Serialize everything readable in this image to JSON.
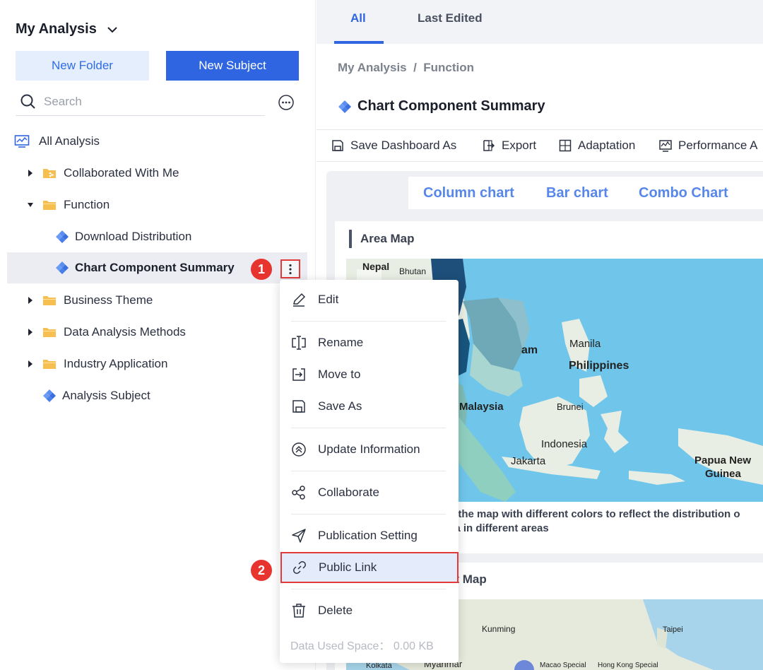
{
  "sidebar": {
    "title": "My Analysis",
    "new_folder_label": "New Folder",
    "new_subject_label": "New Subject",
    "search_placeholder": "Search",
    "tree": {
      "all_analysis": "All Analysis",
      "collaborated": "Collaborated With Me",
      "function": "Function",
      "download_distribution": "Download Distribution",
      "chart_component_summary": "Chart Component Summary",
      "business_theme": "Business Theme",
      "data_analysis_methods": "Data Analysis Methods",
      "industry_application": "Industry Application",
      "analysis_subject": "Analysis Subject"
    }
  },
  "annotations": {
    "step1": "1",
    "step2": "2"
  },
  "main": {
    "tabs": [
      "All",
      "Last Edited"
    ],
    "breadcrumb": "My Analysis  /  Function",
    "title": "Chart Component Summary",
    "toolbar": {
      "save_dashboard_as": "Save Dashboard As",
      "export": "Export",
      "adaptation": "Adaptation",
      "performance": "Performance A"
    },
    "chart_tabs": [
      "Column chart",
      "Bar chart",
      "Combo Chart"
    ],
    "card1_title": "Area Map",
    "card1_caption_line1": "of the map with different colors to reflect the distribution o",
    "card1_caption_line2": "ata in different areas",
    "card2_title": "nt Map",
    "map1_labels": {
      "nepal": "Nepal",
      "bhutan": "Bhutan",
      "am": "am",
      "manila": "Manila",
      "philippines": "Philippines",
      "malaysia": "Malaysia",
      "brunei": "Brunei",
      "indonesia": "Indonesia",
      "jakarta": "Jakarta",
      "papua1": "Papua New",
      "papua2": "Guinea"
    },
    "map2_labels": {
      "kunming": "Kunming",
      "taipei": "Taipei",
      "kolkata": "Kolkata",
      "myanmar": "Myanmar",
      "macao": "Macao Special",
      "hongkong": "Hong Kong Special"
    }
  },
  "context_menu": {
    "edit": "Edit",
    "rename": "Rename",
    "move_to": "Move to",
    "save_as": "Save As",
    "update_information": "Update Information",
    "collaborate": "Collaborate",
    "publication_setting": "Publication Setting",
    "public_link": "Public Link",
    "delete": "Delete",
    "data_used_space": "Data Used Space：  0.00 KB"
  },
  "colors": {
    "primary": "#2f65e0",
    "folder": "#f6bf4f",
    "highlight_border": "#e23a3a",
    "sea": "#6fc6ea"
  }
}
